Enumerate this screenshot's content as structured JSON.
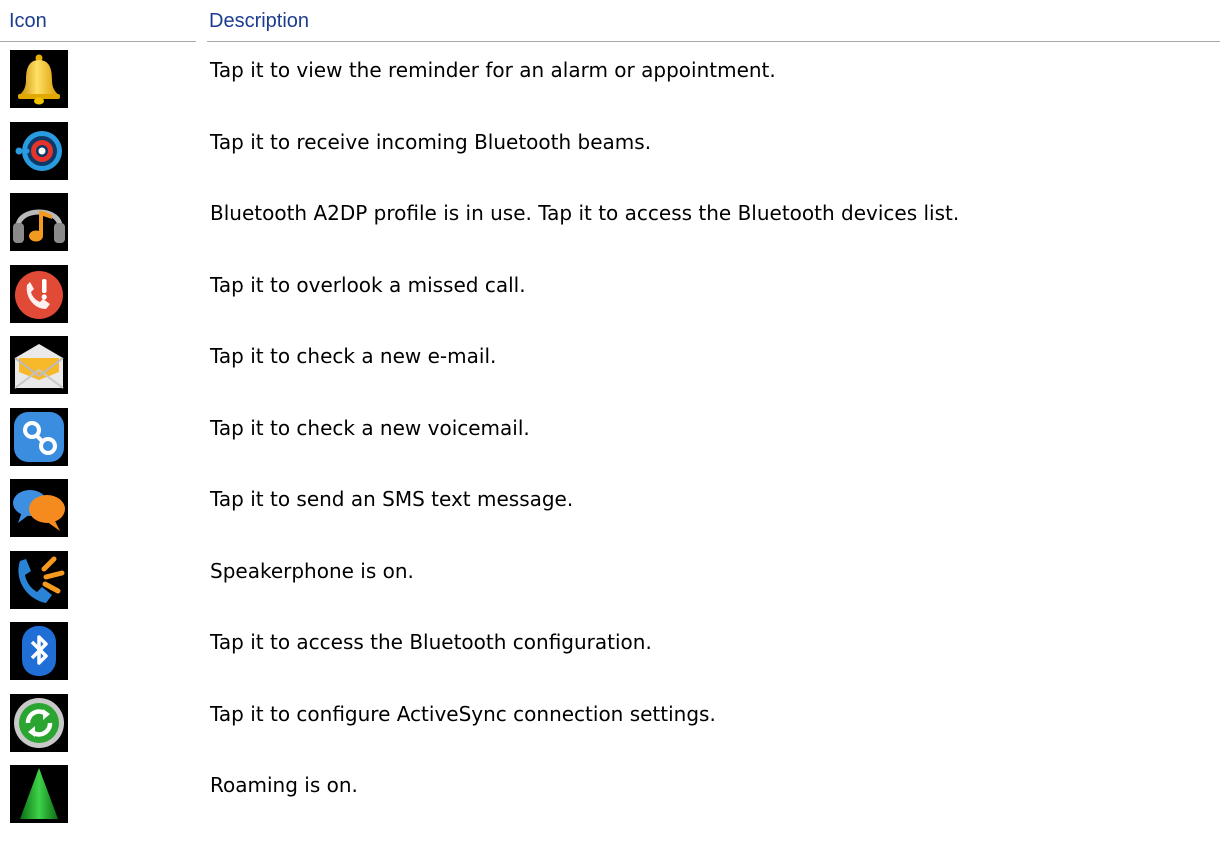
{
  "table": {
    "header": {
      "icon": "Icon",
      "description": "Description"
    },
    "rows": [
      {
        "icon": "bell-icon",
        "description": "Tap it to view the reminder for an alarm or appointment."
      },
      {
        "icon": "bluetooth-beam-icon",
        "description": "Tap it to receive incoming Bluetooth beams."
      },
      {
        "icon": "headphones-music-icon",
        "description": "Bluetooth A2DP profile is in use. Tap it to access the Bluetooth devices list."
      },
      {
        "icon": "missed-call-icon",
        "description": "Tap it to overlook a missed call."
      },
      {
        "icon": "email-icon",
        "description": "Tap it to check a new e-mail."
      },
      {
        "icon": "voicemail-icon",
        "description": "Tap it to check a new voicemail."
      },
      {
        "icon": "sms-icon",
        "description": "Tap it to send an SMS text message."
      },
      {
        "icon": "speakerphone-icon",
        "description": "Speakerphone is on."
      },
      {
        "icon": "bluetooth-icon",
        "description": "Tap it to access the Bluetooth configuration."
      },
      {
        "icon": "activesync-icon",
        "description": "Tap it to configure ActiveSync connection settings."
      },
      {
        "icon": "roaming-icon",
        "description": "Roaming is on."
      }
    ]
  }
}
